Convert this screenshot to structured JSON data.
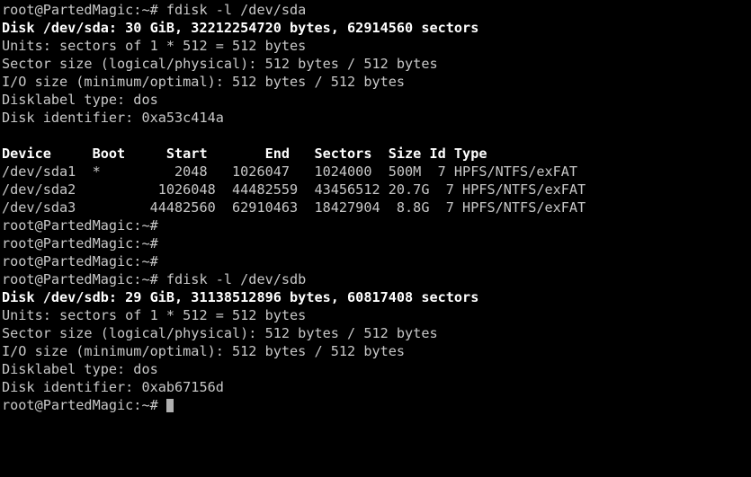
{
  "terminal": {
    "background_color": "#000000",
    "text_color": "#c8c8c8",
    "bold_color": "#ffffff",
    "cursor_color": "#b0b0b0",
    "prompt": "root@PartedMagic:~#",
    "lines": [
      {
        "text": "root@PartedMagic:~# fdisk -l /dev/sda",
        "bold": false
      },
      {
        "text": "Disk /dev/sda: 30 GiB, 32212254720 bytes, 62914560 sectors",
        "bold": true
      },
      {
        "text": "Units: sectors of 1 * 512 = 512 bytes",
        "bold": false
      },
      {
        "text": "Sector size (logical/physical): 512 bytes / 512 bytes",
        "bold": false
      },
      {
        "text": "I/O size (minimum/optimal): 512 bytes / 512 bytes",
        "bold": false
      },
      {
        "text": "Disklabel type: dos",
        "bold": false
      },
      {
        "text": "Disk identifier: 0xa53c414a",
        "bold": false
      },
      {
        "text": "",
        "bold": false
      },
      {
        "text": "Device     Boot     Start       End   Sectors  Size Id Type",
        "bold": true
      },
      {
        "text": "/dev/sda1  *         2048   1026047   1024000  500M  7 HPFS/NTFS/exFAT",
        "bold": false
      },
      {
        "text": "/dev/sda2          1026048  44482559  43456512 20.7G  7 HPFS/NTFS/exFAT",
        "bold": false
      },
      {
        "text": "/dev/sda3         44482560  62910463  18427904  8.8G  7 HPFS/NTFS/exFAT",
        "bold": false
      },
      {
        "text": "root@PartedMagic:~#",
        "bold": false
      },
      {
        "text": "root@PartedMagic:~#",
        "bold": false
      },
      {
        "text": "root@PartedMagic:~#",
        "bold": false
      },
      {
        "text": "root@PartedMagic:~# fdisk -l /dev/sdb",
        "bold": false
      },
      {
        "text": "Disk /dev/sdb: 29 GiB, 31138512896 bytes, 60817408 sectors",
        "bold": true
      },
      {
        "text": "Units: sectors of 1 * 512 = 512 bytes",
        "bold": false
      },
      {
        "text": "Sector size (logical/physical): 512 bytes / 512 bytes",
        "bold": false
      },
      {
        "text": "I/O size (minimum/optimal): 512 bytes / 512 bytes",
        "bold": false
      },
      {
        "text": "Disklabel type: dos",
        "bold": false
      },
      {
        "text": "Disk identifier: 0xab67156d",
        "bold": false
      }
    ],
    "final_prompt": "root@PartedMagic:~# ",
    "commands": [
      "fdisk -l /dev/sda",
      "fdisk -l /dev/sdb"
    ],
    "disks": [
      {
        "device": "/dev/sda",
        "size_human": "30 GiB",
        "size_bytes": "32212254720",
        "sectors": "62914560",
        "units": "sectors of 1 * 512 = 512 bytes",
        "sector_size_logical": "512 bytes",
        "sector_size_physical": "512 bytes",
        "io_size_minimum": "512 bytes",
        "io_size_optimal": "512 bytes",
        "disklabel_type": "dos",
        "disk_identifier": "0xa53c414a",
        "table_headers": [
          "Device",
          "Boot",
          "Start",
          "End",
          "Sectors",
          "Size",
          "Id",
          "Type"
        ],
        "partitions": [
          {
            "device": "/dev/sda1",
            "boot": "*",
            "start": "2048",
            "end": "1026047",
            "sectors": "1024000",
            "size": "500M",
            "id": "7",
            "type": "HPFS/NTFS/exFAT"
          },
          {
            "device": "/dev/sda2",
            "boot": "",
            "start": "1026048",
            "end": "44482559",
            "sectors": "43456512",
            "size": "20.7G",
            "id": "7",
            "type": "HPFS/NTFS/exFAT"
          },
          {
            "device": "/dev/sda3",
            "boot": "",
            "start": "44482560",
            "end": "62910463",
            "sectors": "18427904",
            "size": "8.8G",
            "id": "7",
            "type": "HPFS/NTFS/exFAT"
          }
        ]
      },
      {
        "device": "/dev/sdb",
        "size_human": "29 GiB",
        "size_bytes": "31138512896",
        "sectors": "60817408",
        "units": "sectors of 1 * 512 = 512 bytes",
        "sector_size_logical": "512 bytes",
        "sector_size_physical": "512 bytes",
        "io_size_minimum": "512 bytes",
        "io_size_optimal": "512 bytes",
        "disklabel_type": "dos",
        "disk_identifier": "0xab67156d",
        "table_headers": [],
        "partitions": []
      }
    ]
  }
}
